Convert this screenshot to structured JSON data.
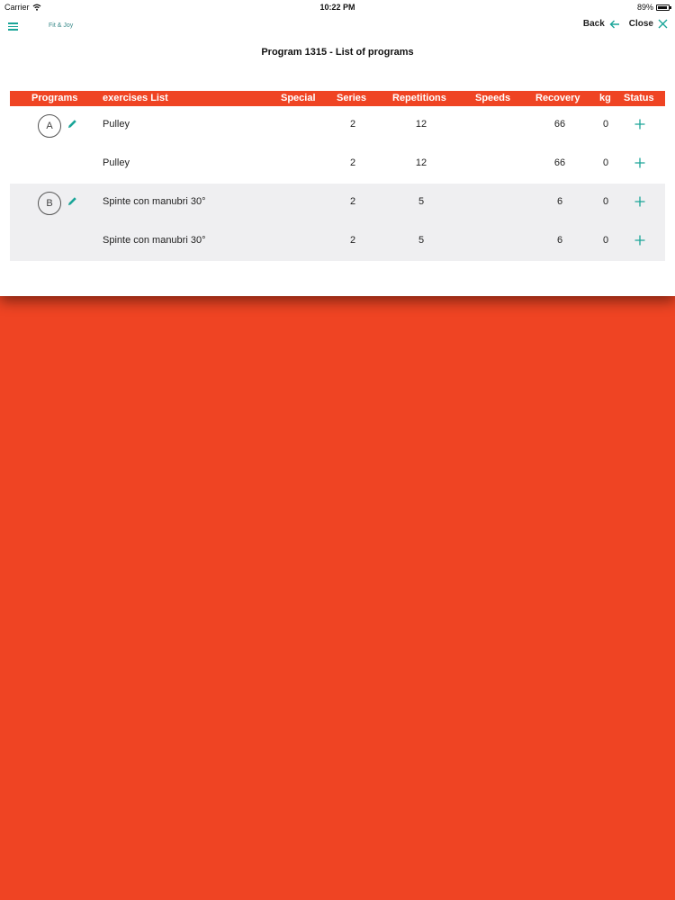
{
  "status_bar": {
    "carrier": "Carrier",
    "time": "10:22 PM",
    "battery_percent": "89%",
    "battery_level": 0.89
  },
  "nav": {
    "brand": "Fit & Joy",
    "back_label": "Back",
    "close_label": "Close"
  },
  "page_title": "Program 1315 - List of programs",
  "colors": {
    "accent": "#ef4423",
    "teal": "#1aa598",
    "row_alt": "#efeff1"
  },
  "table": {
    "headers": [
      "Programs",
      "exercises List",
      "Special",
      "Series",
      "Repetitions",
      "Speeds",
      "Recovery",
      "kg",
      "Status"
    ],
    "rows": [
      {
        "program": "A",
        "exercise": "Pulley",
        "special": "",
        "series": "2",
        "repetitions": "12",
        "speeds": "",
        "recovery": "66",
        "kg": "0"
      },
      {
        "program": "",
        "exercise": "Pulley",
        "special": "",
        "series": "2",
        "repetitions": "12",
        "speeds": "",
        "recovery": "66",
        "kg": "0"
      },
      {
        "program": "B",
        "exercise": "Spinte con manubri 30°",
        "special": "",
        "series": "2",
        "repetitions": "5",
        "speeds": "",
        "recovery": "6",
        "kg": "0"
      },
      {
        "program": "",
        "exercise": "Spinte con manubri 30°",
        "special": "",
        "series": "2",
        "repetitions": "5",
        "speeds": "",
        "recovery": "6",
        "kg": "0"
      }
    ],
    "icons": {
      "edit": "pencil-icon",
      "status": "plus-icon"
    }
  }
}
